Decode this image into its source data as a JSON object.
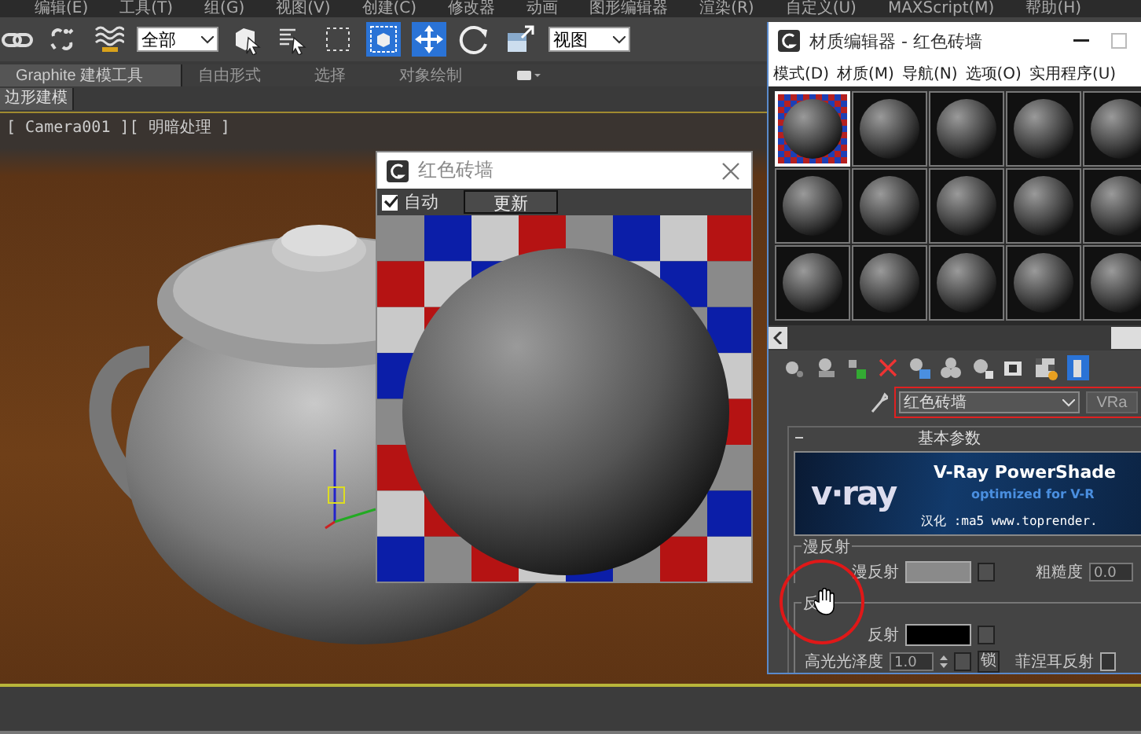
{
  "menu_bar": [
    "编辑(E)",
    "工具(T)",
    "组(G)",
    "视图(V)",
    "创建(C)",
    "修改器",
    "动画",
    "图形编辑器",
    "渲染(R)",
    "自定义(U)",
    "MAXScript(M)",
    "帮助(H)"
  ],
  "toolbar": [
    {
      "kind": "link",
      "active": false
    },
    {
      "kind": "unlink",
      "active": false
    },
    {
      "kind": "bind",
      "active": false
    },
    {
      "kind": "dropdown",
      "value": "全部"
    },
    {
      "kind": "select",
      "active": false
    },
    {
      "kind": "select-by-name",
      "active": false
    },
    {
      "kind": "rect-region",
      "active": false
    },
    {
      "kind": "window-crossing",
      "active": true
    },
    {
      "kind": "move",
      "active": true
    },
    {
      "kind": "rotate",
      "active": false
    },
    {
      "kind": "scale",
      "active": false
    },
    {
      "kind": "dropdown",
      "value": "视图"
    }
  ],
  "ribbon": {
    "tabs": [
      {
        "label": "Graphite 建模工具",
        "selected": true
      },
      {
        "label": "自由形式",
        "selected": false
      },
      {
        "label": "选择",
        "selected": false
      },
      {
        "label": "对象绘制",
        "selected": false
      }
    ],
    "panel": "边形建模"
  },
  "viewport": {
    "label": "[ Camera001 ][ 明暗处理 ]"
  },
  "preview_window": {
    "title": "红色砖墙",
    "auto": {
      "label": "自动",
      "checked": true
    },
    "update_button": "更新"
  },
  "material_editor": {
    "title": "材质编辑器 - 红色砖墙",
    "menus": [
      "模式(D)",
      "材质(M)",
      "导航(N)",
      "选项(O)",
      "实用程序(U)"
    ],
    "slots": [
      {
        "selected": true
      },
      {
        "selected": false
      },
      {
        "selected": false
      },
      {
        "selected": false
      },
      {
        "selected": false
      },
      {
        "selected": false
      },
      {
        "selected": false
      },
      {
        "selected": false
      },
      {
        "selected": false
      },
      {
        "selected": false
      },
      {
        "selected": false
      },
      {
        "selected": false
      },
      {
        "selected": false
      },
      {
        "selected": false
      },
      {
        "selected": false
      }
    ],
    "material_name": "红色砖墙",
    "type_button": "VRa",
    "rollout_title": "基本参数",
    "banner": {
      "logo": "v·ray",
      "product": "V-Ray PowerShade",
      "subtitle": "optimized for V-R",
      "credit": "汉化 :ma5 www.toprender."
    },
    "diffuse": {
      "group_title": "漫反射",
      "label": "漫反射",
      "roughness_label": "粗糙度",
      "roughness": "0.0"
    },
    "reflection": {
      "group_title": "反",
      "label": "反射",
      "glossiness_label": "高光光泽度",
      "glossiness": "1.0",
      "lock": "锁",
      "fresnel_label": "菲涅耳反射",
      "fresnel_checked": false
    }
  }
}
